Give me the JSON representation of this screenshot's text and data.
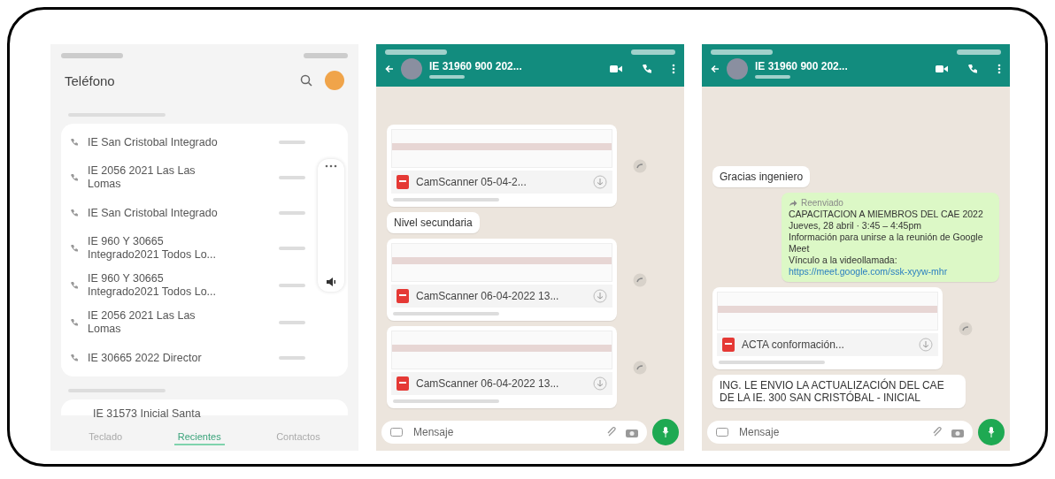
{
  "call_log": {
    "title": "Teléfono",
    "calls": [
      {
        "name": "IE San Cristobal Integrado"
      },
      {
        "name": "IE 2056 2021 Las Las Lomas"
      },
      {
        "name": "IE San Cristobal Integrado"
      },
      {
        "name": "IE 960 Y 30665 Integrado2021 Todos Lo..."
      },
      {
        "name": "IE 960 Y 30665 Integrado2021 Todos Lo..."
      },
      {
        "name": "IE 2056 2021 Las Las Lomas"
      },
      {
        "name": "IE 30665 2022 Director"
      }
    ],
    "partial_call": "IE 31573 Inicial Santa",
    "tabs": [
      {
        "label": "Teclado",
        "selected": false
      },
      {
        "label": "Recientes",
        "selected": true
      },
      {
        "label": "Contactos",
        "selected": false
      }
    ]
  },
  "chats": [
    {
      "title": "IE 31960 900 202...",
      "messages": [
        {
          "kind": "document",
          "file": "CamScanner 05-04-2..."
        },
        {
          "kind": "text",
          "text": "Nivel secundaria",
          "outgoing": false
        },
        {
          "kind": "document",
          "file": "CamScanner 06-04-2022 13..."
        },
        {
          "kind": "document",
          "file": "CamScanner 06-04-2022 13..."
        }
      ],
      "placeholder": "Mensaje"
    },
    {
      "title": "IE 31960 900 202...",
      "messages": [
        {
          "kind": "text",
          "text": "Gracias ingeniero",
          "outgoing": false
        },
        {
          "kind": "forwarded",
          "label": "Reenviado",
          "lines": [
            "CAPACITACION A MIEMBROS DEL CAE 2022",
            "Jueves, 28 abril · 3:45 – 4:45pm",
            "Información para unirse a la reunión de Google Meet",
            "Vínculo a la videollamada:"
          ],
          "link": "https://meet.google.com/ssk-xyyw-mhr"
        },
        {
          "kind": "document",
          "file": "ACTA conformación..."
        },
        {
          "kind": "text",
          "text": "ING. LE ENVIO LA ACTUALIZACIÓN DEL CAE DE LA IE. 300 SAN CRISTÓBAL - INICIAL",
          "outgoing": false
        }
      ],
      "placeholder": "Mensaje"
    }
  ]
}
